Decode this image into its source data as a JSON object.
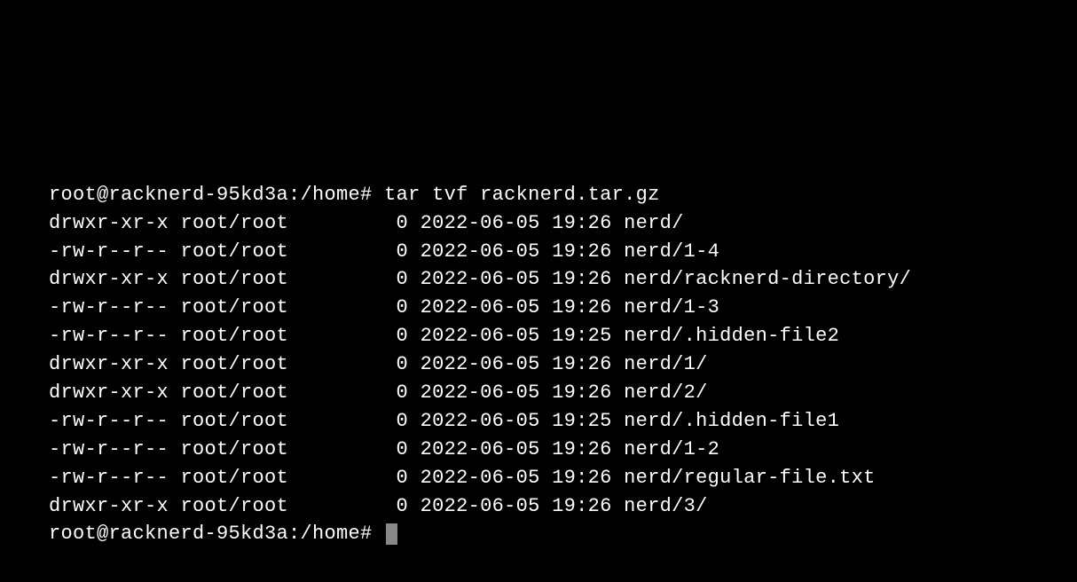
{
  "prompt1": "root@racknerd-95kd3a:/home#",
  "command": "tar tvf racknerd.tar.gz",
  "prompt2": "root@racknerd-95kd3a:/home#",
  "entries": [
    {
      "perms": "drwxr-xr-x",
      "owner": "root/root",
      "size": "0",
      "date": "2022-06-05",
      "time": "19:26",
      "name": "nerd/"
    },
    {
      "perms": "-rw-r--r--",
      "owner": "root/root",
      "size": "0",
      "date": "2022-06-05",
      "time": "19:26",
      "name": "nerd/1-4"
    },
    {
      "perms": "drwxr-xr-x",
      "owner": "root/root",
      "size": "0",
      "date": "2022-06-05",
      "time": "19:26",
      "name": "nerd/racknerd-directory/"
    },
    {
      "perms": "-rw-r--r--",
      "owner": "root/root",
      "size": "0",
      "date": "2022-06-05",
      "time": "19:26",
      "name": "nerd/1-3"
    },
    {
      "perms": "-rw-r--r--",
      "owner": "root/root",
      "size": "0",
      "date": "2022-06-05",
      "time": "19:25",
      "name": "nerd/.hidden-file2"
    },
    {
      "perms": "drwxr-xr-x",
      "owner": "root/root",
      "size": "0",
      "date": "2022-06-05",
      "time": "19:26",
      "name": "nerd/1/"
    },
    {
      "perms": "drwxr-xr-x",
      "owner": "root/root",
      "size": "0",
      "date": "2022-06-05",
      "time": "19:26",
      "name": "nerd/2/"
    },
    {
      "perms": "-rw-r--r--",
      "owner": "root/root",
      "size": "0",
      "date": "2022-06-05",
      "time": "19:25",
      "name": "nerd/.hidden-file1"
    },
    {
      "perms": "-rw-r--r--",
      "owner": "root/root",
      "size": "0",
      "date": "2022-06-05",
      "time": "19:26",
      "name": "nerd/1-2"
    },
    {
      "perms": "-rw-r--r--",
      "owner": "root/root",
      "size": "0",
      "date": "2022-06-05",
      "time": "19:26",
      "name": "nerd/regular-file.txt"
    },
    {
      "perms": "drwxr-xr-x",
      "owner": "root/root",
      "size": "0",
      "date": "2022-06-05",
      "time": "19:26",
      "name": "nerd/3/"
    }
  ]
}
